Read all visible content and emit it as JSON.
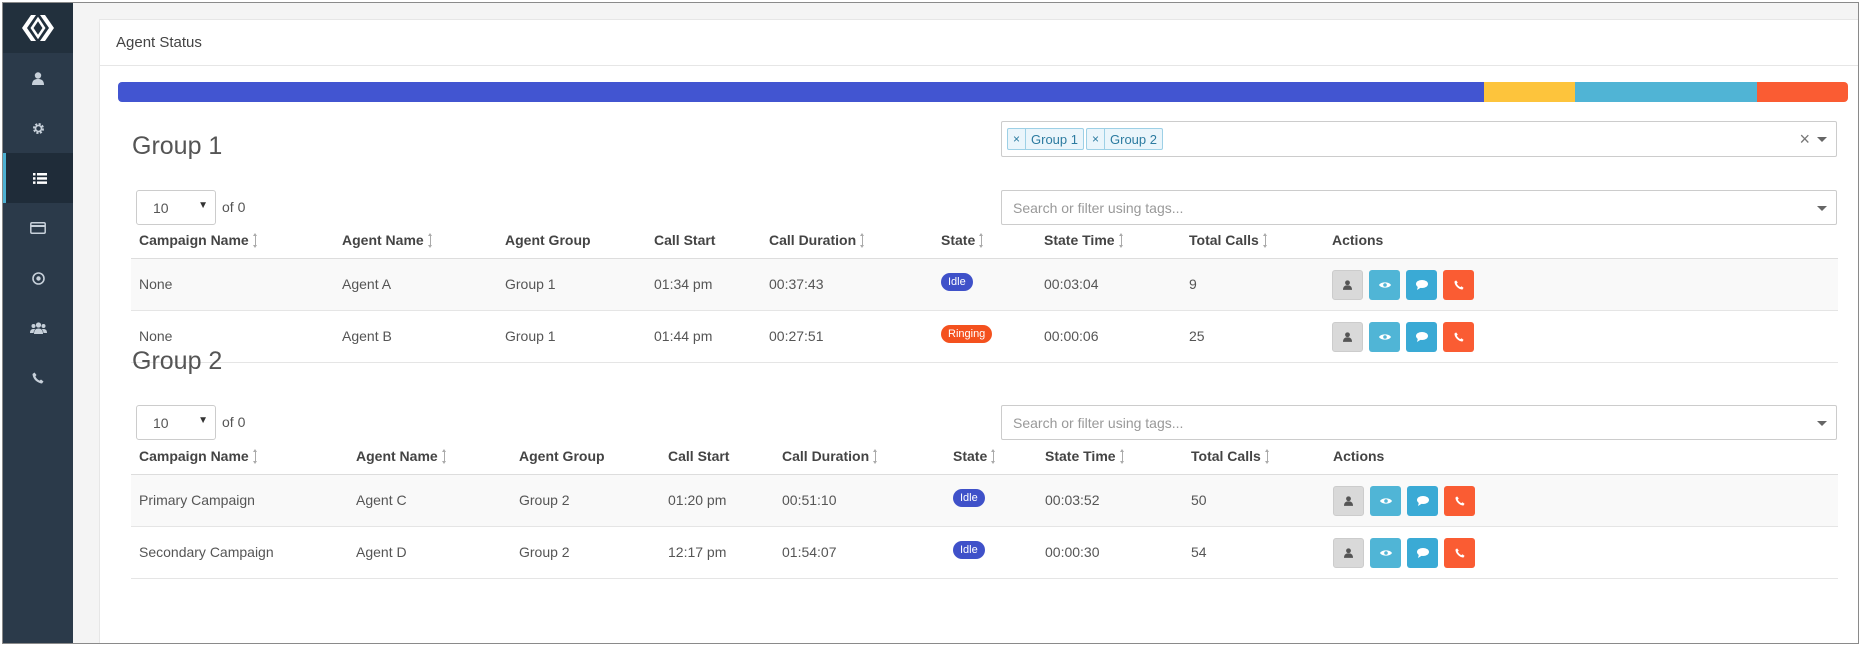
{
  "header": {
    "title": "Agent Status"
  },
  "status_bar": {
    "segments": [
      {
        "state": "idle",
        "fraction": 0.7895,
        "color": "#4255d1"
      },
      {
        "state": "unknown-1",
        "fraction": 0.0528,
        "color": "#fdc43c"
      },
      {
        "state": "unknown-2",
        "fraction": 0.1052,
        "color": "#50b4d5"
      },
      {
        "state": "ringing",
        "fraction": 0.0525,
        "color": "#fa5c33"
      }
    ]
  },
  "group_filter": {
    "tags": [
      "Group 1",
      "Group 2"
    ],
    "tag_remove": "×",
    "clear": "×"
  },
  "columns": {
    "campaign": "Campaign Name",
    "agent": "Agent Name",
    "group": "Agent Group",
    "call_start": "Call Start",
    "duration": "Call Duration",
    "state": "State",
    "state_time": "State Time",
    "total_calls": "Total Calls",
    "actions": "Actions"
  },
  "groups": [
    {
      "title": "Group 1",
      "page_size": "10",
      "of_count": "of 0",
      "filter_placeholder": "Search or filter using tags...",
      "rows": [
        {
          "campaign": "None",
          "agent": "Agent A",
          "group": "Group 1",
          "call_start": "01:34 pm",
          "duration": "00:37:43",
          "state": "Idle",
          "state_color": "#3f51c9",
          "state_time": "00:03:04",
          "total_calls": "9"
        },
        {
          "campaign": "None",
          "agent": "Agent B",
          "group": "Group 1",
          "call_start": "01:44 pm",
          "duration": "00:27:51",
          "state": "Ringing",
          "state_color": "#f4511e",
          "state_time": "00:00:06",
          "total_calls": "25"
        }
      ]
    },
    {
      "title": "Group 2",
      "page_size": "10",
      "of_count": "of 0",
      "filter_placeholder": "Search or filter using tags...",
      "rows": [
        {
          "campaign": "Primary Campaign",
          "agent": "Agent C",
          "group": "Group 2",
          "call_start": "01:20 pm",
          "duration": "00:51:10",
          "state": "Idle",
          "state_color": "#3f51c9",
          "state_time": "00:03:52",
          "total_calls": "50"
        },
        {
          "campaign": "Secondary Campaign",
          "agent": "Agent D",
          "group": "Group 2",
          "call_start": "12:17 pm",
          "duration": "01:54:07",
          "state": "Idle",
          "state_color": "#3f51c9",
          "state_time": "00:00:30",
          "total_calls": "54"
        }
      ]
    }
  ],
  "sidebar": {
    "items": [
      {
        "icon": "user-icon"
      },
      {
        "icon": "gear-icon"
      },
      {
        "icon": "list-icon",
        "active": true
      },
      {
        "icon": "card-icon"
      },
      {
        "icon": "target-icon"
      },
      {
        "icon": "users-icon"
      },
      {
        "icon": "phone-icon"
      }
    ]
  },
  "colors": {
    "sidebar": "#2b3a4a",
    "accent": "#4cb1d3"
  }
}
